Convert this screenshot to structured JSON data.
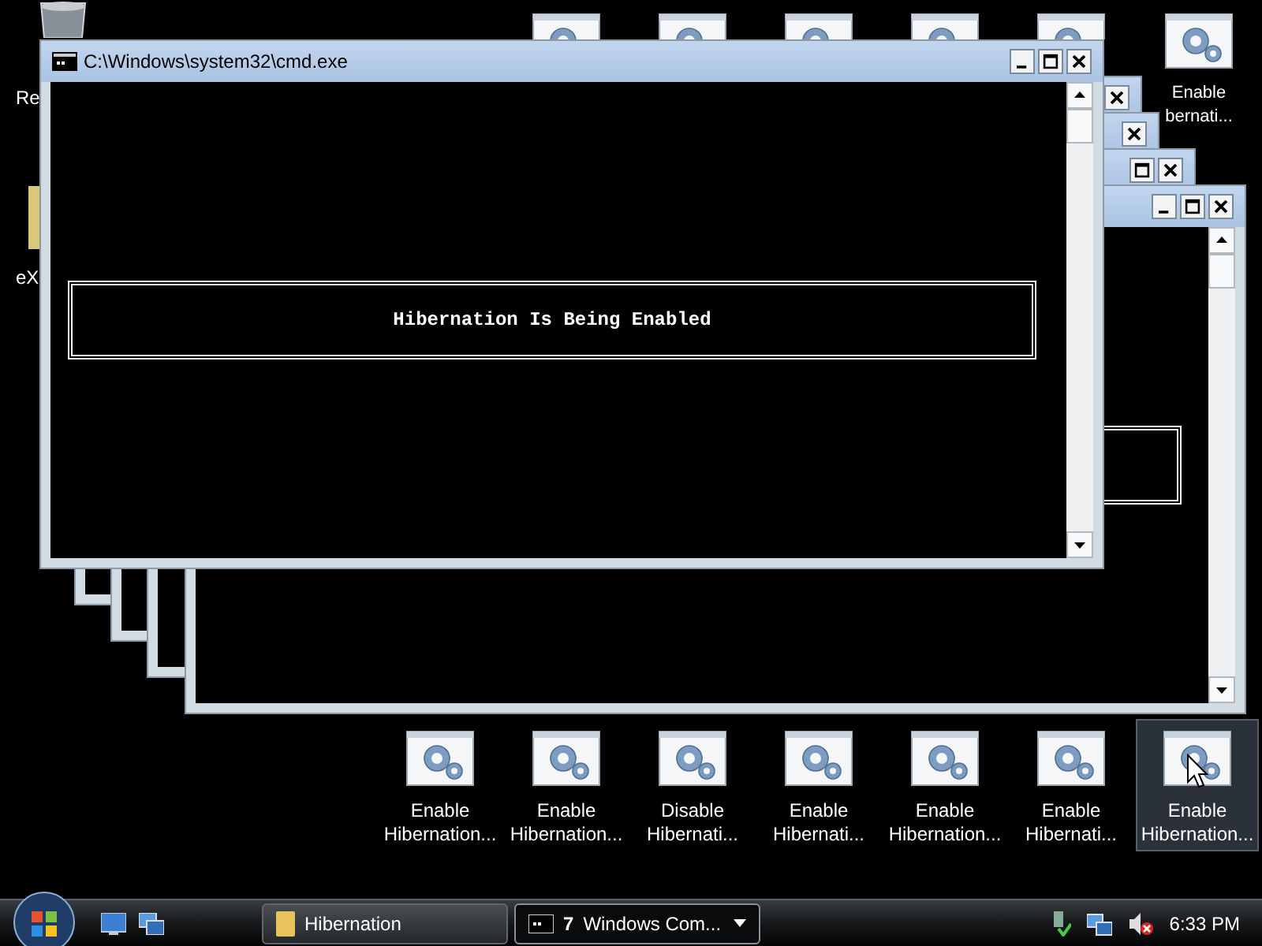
{
  "left_icons": [
    {
      "label": "Re"
    },
    {
      "label": "eX"
    }
  ],
  "top_right_icon": {
    "lines": [
      "Enable",
      "bernati..."
    ]
  },
  "cmd_window": {
    "title": "C:\\Windows\\system32\\cmd.exe",
    "message": "Hibernation Is Being Enabled"
  },
  "bottom_icons": [
    {
      "lines": [
        "Enable",
        "Hibernation..."
      ],
      "selected": false
    },
    {
      "lines": [
        "Enable",
        "Hibernation..."
      ],
      "selected": false
    },
    {
      "lines": [
        "Disable",
        "Hibernati..."
      ],
      "selected": false
    },
    {
      "lines": [
        "Enable",
        "Hibernati..."
      ],
      "selected": false
    },
    {
      "lines": [
        "Enable",
        "Hibernation..."
      ],
      "selected": false
    },
    {
      "lines": [
        "Enable",
        "Hibernati..."
      ],
      "selected": false
    },
    {
      "lines": [
        "Enable",
        "Hibernation..."
      ],
      "selected": true
    }
  ],
  "taskbar": {
    "buttons": [
      {
        "kind": "folder",
        "label": "Hibernation",
        "selected": false
      },
      {
        "kind": "cmd",
        "count": "7",
        "label": "Windows Com...",
        "selected": true
      }
    ],
    "clock": "6:33 PM"
  }
}
